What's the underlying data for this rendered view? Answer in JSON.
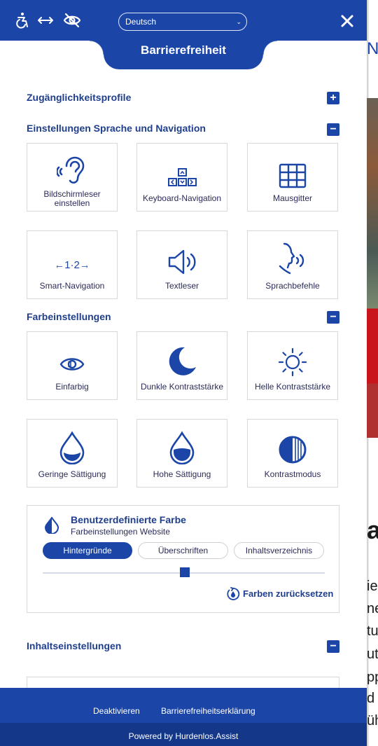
{
  "background_page": {
    "edge_glyphs": [
      "N",
      "a",
      "ie",
      "ne",
      "tul",
      "ut",
      "pp",
      "d I",
      "üh"
    ]
  },
  "topbar": {
    "icons": [
      "accessibility-person-icon",
      "resize-horizontal-icon",
      "visibility-off-icon"
    ],
    "language": "Deutsch",
    "close_icon": "close-icon",
    "tab_title": "Barrierefreiheit"
  },
  "sections": {
    "profiles": {
      "title": "Zugänglichkeitsprofile",
      "toggle": "+"
    },
    "language_navigation": {
      "title": "Einstellungen Sprache und Navigation",
      "toggle": "−",
      "cards": [
        {
          "label": "Bildschirmleser einstellen",
          "icon": "ear-sound-icon"
        },
        {
          "label": "Keyboard-Navigation",
          "icon": "arrow-keys-icon"
        },
        {
          "label": "Mausgitter",
          "icon": "grid-icon"
        },
        {
          "label": "Smart-Navigation",
          "icon": "smart-navigation-icon"
        },
        {
          "label": "Textleser",
          "icon": "speaker-icon"
        },
        {
          "label": "Sprachbefehle",
          "icon": "voice-head-icon"
        }
      ]
    },
    "color": {
      "title": "Farbeinstellungen",
      "toggle": "−",
      "cards": [
        {
          "label": "Einfarbig",
          "icon": "monochrome-eye-icon"
        },
        {
          "label": "Dunkle Kontraststärke",
          "icon": "moon-icon"
        },
        {
          "label": "Helle Kontraststärke",
          "icon": "sun-icon"
        },
        {
          "label": "Geringe Sättigung",
          "icon": "drop-low-icon"
        },
        {
          "label": "Hohe Sättigung",
          "icon": "drop-high-icon"
        },
        {
          "label": "Kontrastmodus",
          "icon": "contrast-mode-icon"
        }
      ]
    },
    "custom_color": {
      "title": "Benutzerdefinierte Farbe",
      "subtitle": "Farbeinstellungen Website",
      "tabs": [
        "Hintergründe",
        "Überschriften",
        "Inhaltsverzeichnis"
      ],
      "active_tab": "Hintergründe",
      "slider_value": 0.5,
      "reset_label": "Farben zurücksetzen"
    },
    "content": {
      "title": "Inhaltseinstellungen",
      "toggle": "−"
    }
  },
  "footer": {
    "links": [
      "Deaktivieren",
      "Barrierefreiheitserklärung"
    ],
    "powered_by": "Powered by Hurdenlos.Assist"
  },
  "colors": {
    "primary": "#1b46a8",
    "heading": "#1f3e8c",
    "footer_bottom": "#15378a"
  }
}
